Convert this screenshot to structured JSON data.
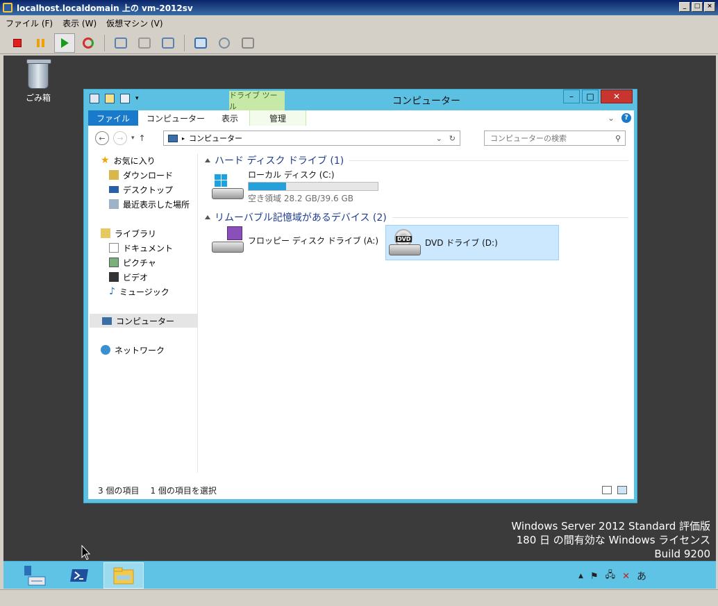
{
  "host": {
    "title": "localhost.localdomain 上の vm-2012sv",
    "menu": [
      "ファイル (F)",
      "表示 (W)",
      "仮想マシン (V)"
    ],
    "toolbar_icons": [
      "stop-icon",
      "pause-icon",
      "play-icon",
      "reset-icon",
      "snapshot-icon",
      "snapshot-revert-icon",
      "snapshot-manager-icon",
      "console-settings-icon",
      "tools-icon",
      "vm-settings-icon"
    ]
  },
  "desktop": {
    "recycle_bin_label": "ごみ箱",
    "watermark": {
      "line1": "Windows Server 2012 Standard 評価版",
      "line2": "180 日 の間有効な Windows ライセンス",
      "line3": "Build 9200"
    }
  },
  "taskbar": {
    "items": [
      "server-manager",
      "powershell",
      "file-explorer"
    ],
    "ime": "あ"
  },
  "explorer": {
    "title": "コンピューター",
    "contextual_tab_group": "ドライブ ツール",
    "ribbon_tabs": [
      "ファイル",
      "コンピューター",
      "表示",
      "管理"
    ],
    "address_path": "コンピューター",
    "search_placeholder": "コンピューターの検索",
    "nav": {
      "favorites": "お気に入り",
      "downloads": "ダウンロード",
      "desktop": "デスクトップ",
      "recent": "最近表示した場所",
      "libraries": "ライブラリ",
      "documents": "ドキュメント",
      "pictures": "ピクチャ",
      "videos": "ビデオ",
      "music": "ミュージック",
      "computer": "コンピューター",
      "network": "ネットワーク"
    },
    "groups": {
      "hdd": "ハード ディスク ドライブ (1)",
      "removable": "リムーバブル記憶域があるデバイス (2)"
    },
    "drives": {
      "c": {
        "name": "ローカル ディスク (C:)",
        "free_text": "空き領域 28.2 GB/39.6 GB",
        "used_fraction": 0.29
      },
      "a": {
        "name": "フロッピー ディスク ドライブ (A:)"
      },
      "d": {
        "name": "DVD ドライブ (D:)",
        "badge": "DVD"
      }
    },
    "status": {
      "count": "3 個の項目",
      "selected": "1 個の項目を選択"
    }
  }
}
